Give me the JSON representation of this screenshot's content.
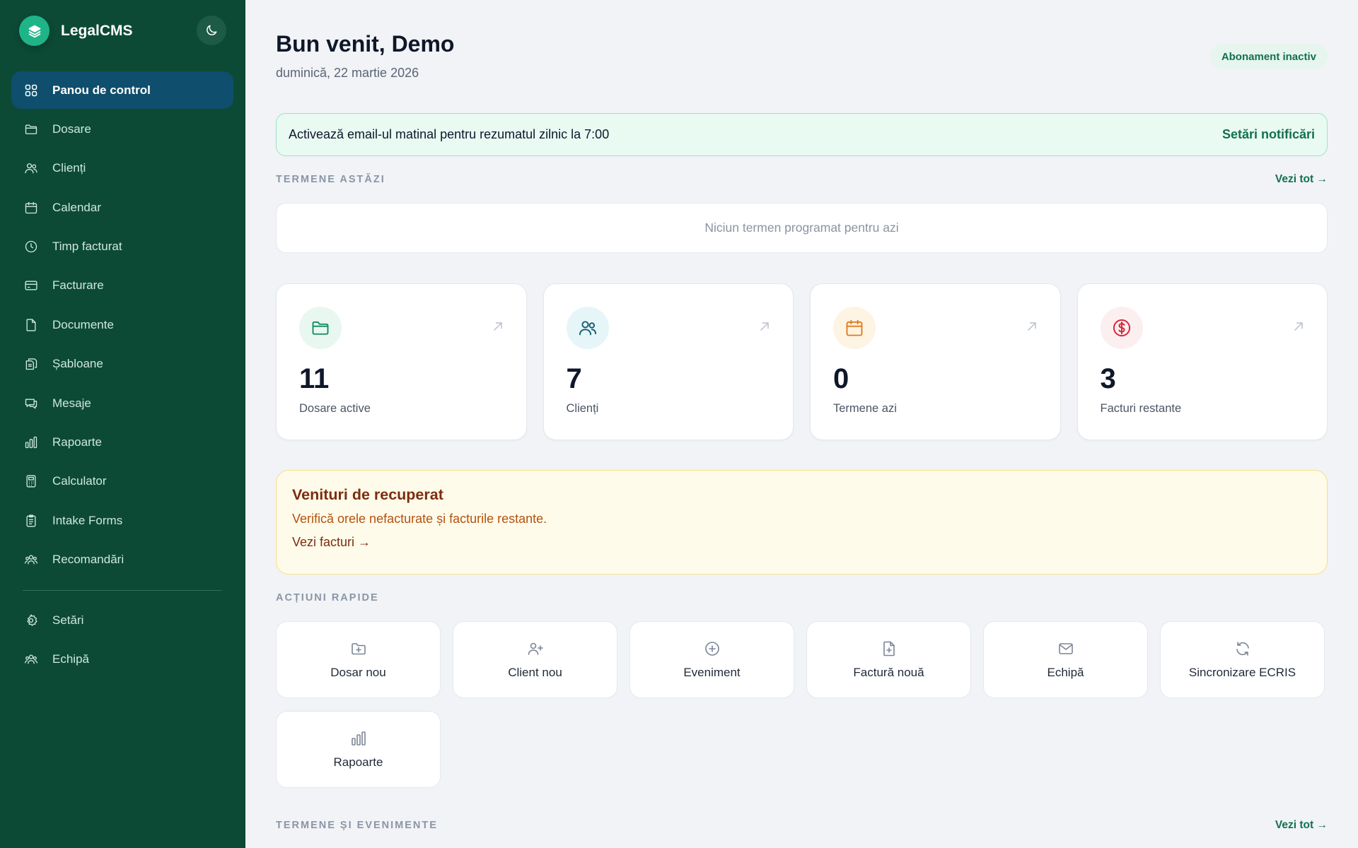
{
  "app": {
    "name": "LegalCMS"
  },
  "sidebar": {
    "items": [
      {
        "label": "Panou de control",
        "icon": "grid-icon",
        "active": true
      },
      {
        "label": "Dosare",
        "icon": "folder-icon"
      },
      {
        "label": "Clienți",
        "icon": "users-icon"
      },
      {
        "label": "Calendar",
        "icon": "calendar-icon"
      },
      {
        "label": "Timp facturat",
        "icon": "clock-icon"
      },
      {
        "label": "Facturare",
        "icon": "credit-card-icon"
      },
      {
        "label": "Documente",
        "icon": "file-icon"
      },
      {
        "label": "Șabloane",
        "icon": "template-icon"
      },
      {
        "label": "Mesaje",
        "icon": "message-icon"
      },
      {
        "label": "Rapoarte",
        "icon": "bar-chart-icon"
      },
      {
        "label": "Calculator",
        "icon": "calculator-icon"
      },
      {
        "label": "Intake Forms",
        "icon": "clipboard-icon"
      },
      {
        "label": "Recomandări",
        "icon": "users-group-icon"
      }
    ],
    "bottom_items": [
      {
        "label": "Setări",
        "icon": "gear-icon"
      },
      {
        "label": "Echipă",
        "icon": "team-icon"
      }
    ]
  },
  "header": {
    "title": "Bun venit, Demo",
    "date": "duminică, 22 martie 2026",
    "subscription_badge": "Abonament inactiv"
  },
  "notification": {
    "text": "Activează email-ul matinal pentru rezumatul zilnic la 7:00",
    "link": "Setări notificări"
  },
  "today_deadlines": {
    "label": "TERMENE ASTĂZI",
    "see_all": "Vezi tot →",
    "empty": "Niciun termen programat pentru azi"
  },
  "stats": [
    {
      "value": "11",
      "label": "Dosare active",
      "icon": "folder-icon",
      "color": "#0f8a63",
      "bg": "#e8f7f0"
    },
    {
      "value": "7",
      "label": "Clienți",
      "icon": "users-icon",
      "color": "#0f5e6e",
      "bg": "#e6f6f8"
    },
    {
      "value": "0",
      "label": "Termene azi",
      "icon": "calendar-icon",
      "color": "#e07a1a",
      "bg": "#fdf4e4"
    },
    {
      "value": "3",
      "label": "Facturi restante",
      "icon": "dollar-icon",
      "color": "#d7263d",
      "bg": "#fcefef"
    }
  ],
  "revenue": {
    "title": "Venituri de recuperat",
    "text": "Verifică orele nefacturate și facturile restante.",
    "link": "Vezi facturi →"
  },
  "quick_actions": {
    "label": "ACȚIUNI RAPIDE",
    "items": [
      {
        "label": "Dosar nou",
        "icon": "folder-plus-icon"
      },
      {
        "label": "Client nou",
        "icon": "user-plus-icon"
      },
      {
        "label": "Eveniment",
        "icon": "plus-circle-icon"
      },
      {
        "label": "Factură nouă",
        "icon": "file-plus-icon"
      },
      {
        "label": "Echipă",
        "icon": "mail-icon"
      },
      {
        "label": "Sincronizare ECRIS",
        "icon": "refresh-icon"
      },
      {
        "label": "Rapoarte",
        "icon": "bar-chart-icon"
      }
    ]
  },
  "events": {
    "label": "TERMENE ȘI EVENIMENTE",
    "see_all": "Vezi tot →"
  },
  "colors": {
    "sidebar_bg": "#0c4a36",
    "active_nav": "#0f4e6c",
    "accent": "#13704f",
    "brand_logo": "#1fb488"
  }
}
